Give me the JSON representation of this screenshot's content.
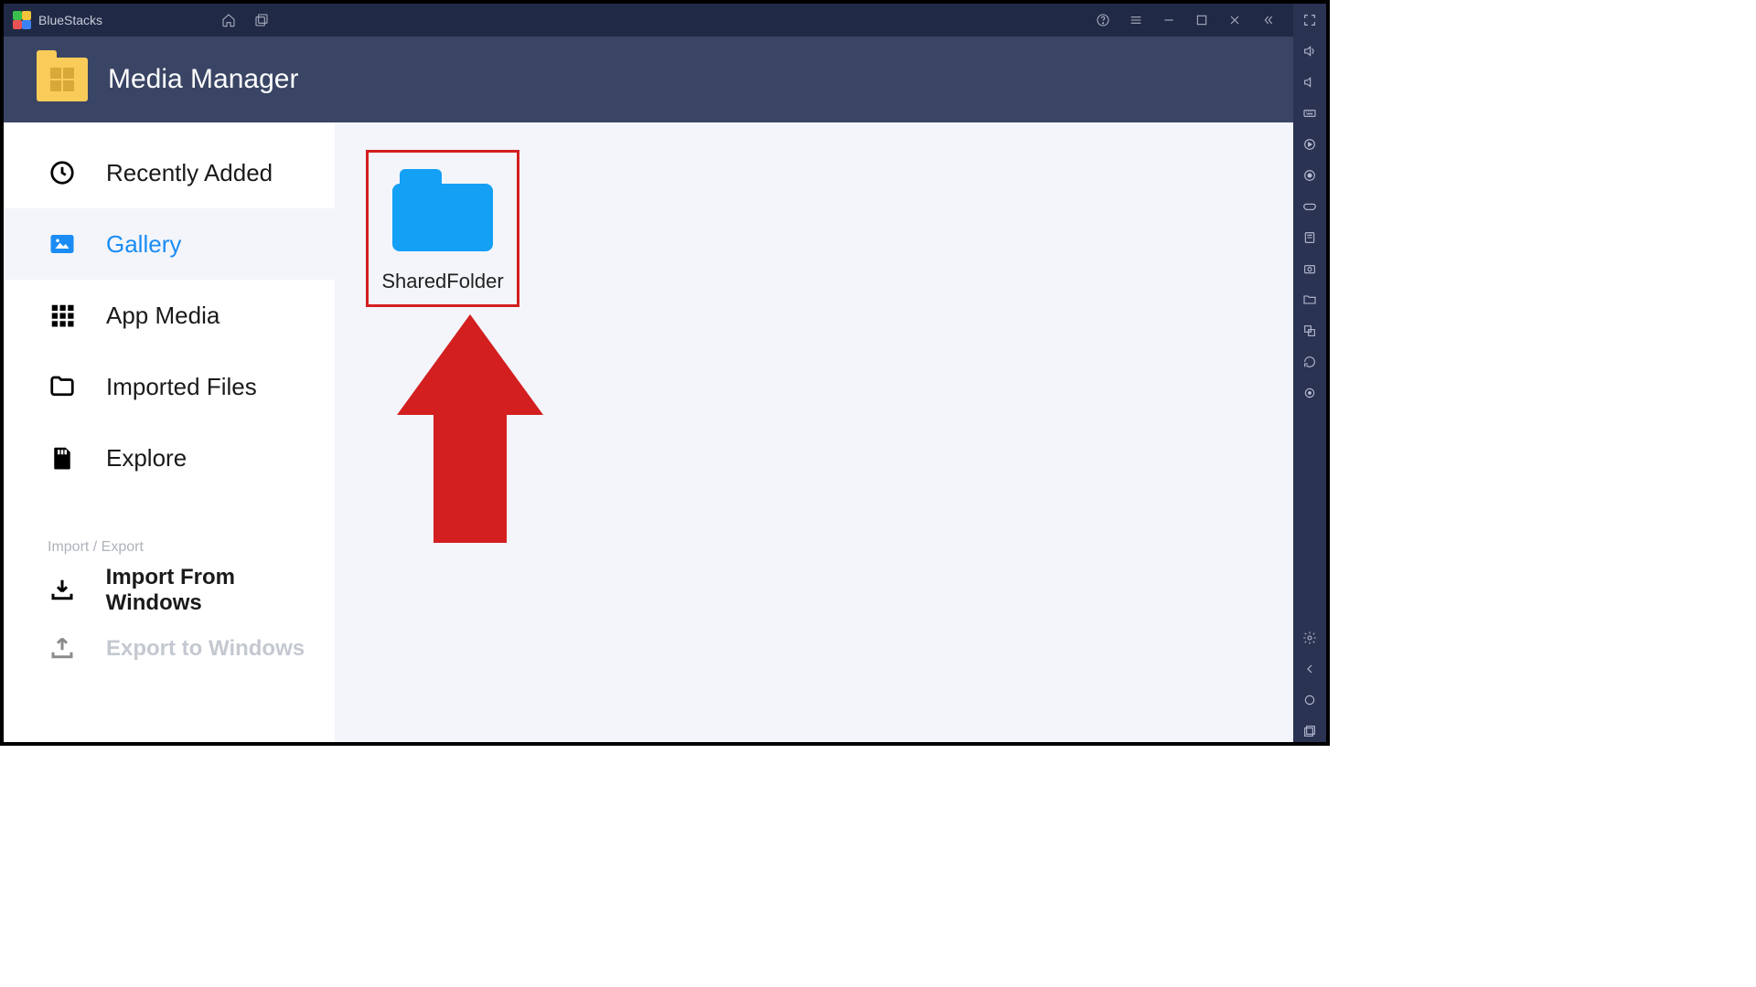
{
  "titlebar": {
    "app_name": "BlueStacks"
  },
  "header": {
    "title": "Media Manager"
  },
  "sidebar": {
    "nav": [
      {
        "label": "Recently Added",
        "icon": "clock-icon"
      },
      {
        "label": "Gallery",
        "icon": "image-icon"
      },
      {
        "label": "App Media",
        "icon": "apps-icon"
      },
      {
        "label": "Imported Files",
        "icon": "folder-outline-icon"
      },
      {
        "label": "Explore",
        "icon": "sd-card-icon"
      }
    ],
    "section_label": "Import / Export",
    "actions": [
      {
        "label": "Import From Windows",
        "icon": "import-icon"
      },
      {
        "label": "Export to Windows",
        "icon": "export-icon"
      }
    ]
  },
  "content": {
    "folders": [
      {
        "name": "SharedFolder"
      }
    ]
  },
  "colors": {
    "accent": "#1b8cf3",
    "header_bg": "#3a4565",
    "titlebar_bg": "#202a46",
    "annotation": "#d31f1f"
  }
}
